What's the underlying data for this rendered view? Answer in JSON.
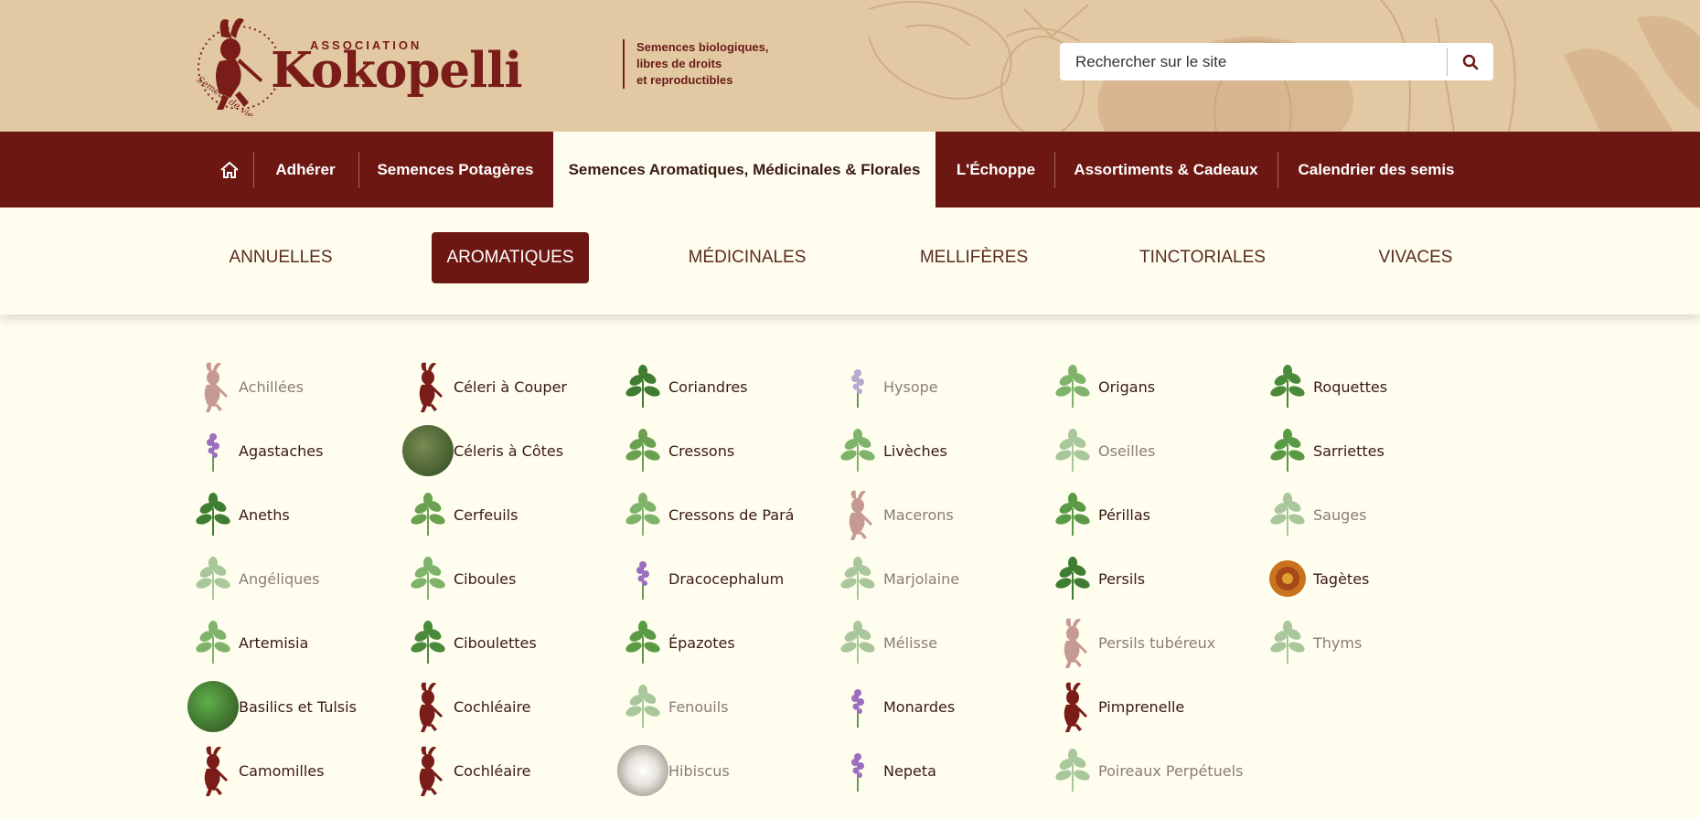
{
  "header": {
    "logo": {
      "association": "ASSOCIATION",
      "name": "Kokopelli",
      "motto": "Semeur de vie"
    },
    "tagline": [
      "Semences biologiques,",
      "libres de droits",
      "et reproductibles"
    ],
    "search": {
      "placeholder": "Rechercher sur le site",
      "icon": "search-icon"
    }
  },
  "nav": {
    "home_icon": "home-icon",
    "items": [
      {
        "label": "Adhérer"
      },
      {
        "label": "Semences Potagères"
      },
      {
        "label": "Semences Aromatiques, Médicinales & Florales",
        "active": true
      },
      {
        "label": "L'Échoppe"
      },
      {
        "label": "Assortiments & Cadeaux"
      },
      {
        "label": "Calendrier des semis"
      }
    ]
  },
  "subnav": {
    "items": [
      {
        "label": "ANNUELLES"
      },
      {
        "label": "AROMATIQUES",
        "active": true
      },
      {
        "label": "MÉDICINALES"
      },
      {
        "label": "MELLIFÈRES"
      },
      {
        "label": "TINCTORIALES"
      },
      {
        "label": "VIVACES"
      }
    ]
  },
  "colors": {
    "brand": "#6d1713",
    "header_bg": "#e2c9a3",
    "page_bg": "#fffdee",
    "dim_text": "#8a7d76"
  },
  "grid": {
    "columns": [
      [
        {
          "label": "Achillées",
          "dim": true,
          "icon": "kokopelli-icon"
        },
        {
          "label": "Agastaches",
          "icon": "agastache-icon"
        },
        {
          "label": "Aneths",
          "icon": "dill-icon"
        },
        {
          "label": "Angéliques",
          "dim": true,
          "icon": "angelica-icon"
        },
        {
          "label": "Artemisia",
          "icon": "artemisia-icon"
        },
        {
          "label": "Basilics et Tulsis",
          "icon": "basil-photo-icon"
        },
        {
          "label": "Camomilles",
          "icon": "kokopelli-icon"
        }
      ],
      [
        {
          "label": "Céleri à Couper",
          "icon": "kokopelli-icon"
        },
        {
          "label": "Céleris à Côtes",
          "icon": "celery-photo-icon"
        },
        {
          "label": "Cerfeuils",
          "icon": "chervil-icon"
        },
        {
          "label": "Ciboules",
          "icon": "scallion-icon"
        },
        {
          "label": "Ciboulettes",
          "icon": "chives-icon"
        },
        {
          "label": "Cochléaire",
          "icon": "kokopelli-icon"
        },
        {
          "label": "Cochléaire",
          "icon": "kokopelli-icon"
        }
      ],
      [
        {
          "label": "Coriandres",
          "icon": "coriander-icon"
        },
        {
          "label": "Cressons",
          "icon": "cress-icon"
        },
        {
          "label": "Cressons de Pará",
          "icon": "para-cress-icon"
        },
        {
          "label": "Dracocephalum",
          "icon": "dracocephalum-icon"
        },
        {
          "label": "Épazotes",
          "icon": "epazote-icon"
        },
        {
          "label": "Fenouils",
          "dim": true,
          "icon": "fennel-icon"
        },
        {
          "label": "Hibiscus",
          "dim": true,
          "icon": "hibiscus-photo-icon"
        }
      ],
      [
        {
          "label": "Hysope",
          "dim": true,
          "icon": "hyssop-icon"
        },
        {
          "label": "Livèches",
          "icon": "lovage-icon"
        },
        {
          "label": "Macerons",
          "dim": true,
          "icon": "kokopelli-icon"
        },
        {
          "label": "Marjolaine",
          "dim": true,
          "icon": "marjoram-icon"
        },
        {
          "label": "Mélisse",
          "dim": true,
          "icon": "lemon-balm-icon"
        },
        {
          "label": "Monardes",
          "icon": "monarda-icon"
        },
        {
          "label": "Nepeta",
          "icon": "nepeta-icon"
        }
      ],
      [
        {
          "label": "Origans",
          "icon": "oregano-icon"
        },
        {
          "label": "Oseilles",
          "dim": true,
          "icon": "sorrel-icon"
        },
        {
          "label": "Périllas",
          "icon": "perilla-icon"
        },
        {
          "label": "Persils",
          "icon": "parsley-icon"
        },
        {
          "label": "Persils tubéreux",
          "dim": true,
          "icon": "kokopelli-icon"
        },
        {
          "label": "Pimprenelle",
          "icon": "kokopelli-icon"
        },
        {
          "label": "Poireaux Perpétuels",
          "dim": true,
          "icon": "leek-icon"
        }
      ],
      [
        {
          "label": "Roquettes",
          "icon": "arugula-icon"
        },
        {
          "label": "Sarriettes",
          "icon": "savory-icon"
        },
        {
          "label": "Sauges",
          "dim": true,
          "icon": "sage-icon"
        },
        {
          "label": "Tagètes",
          "icon": "marigold-icon"
        },
        {
          "label": "Thyms",
          "dim": true,
          "icon": "thyme-icon"
        }
      ]
    ]
  }
}
